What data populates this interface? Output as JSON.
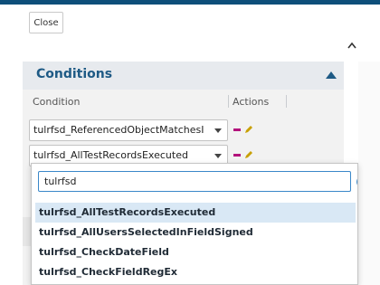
{
  "toolbar": {
    "close_label": "Close"
  },
  "conditions": {
    "title": "Conditions",
    "columns": {
      "condition": "Condition",
      "actions": "Actions"
    },
    "rows": [
      {
        "value": "tulrfsd_ReferencedObjectMatchesI"
      },
      {
        "value": "tulrfsd_AllTestRecordsExecuted"
      }
    ]
  },
  "dropdown": {
    "search_value": "tulrfsd",
    "options": [
      {
        "label": "tulrfsd_AllTestRecordsExecuted",
        "highlighted": true
      },
      {
        "label": "tulrfsd_AllUsersSelectedInFieldSigned",
        "highlighted": false
      },
      {
        "label": "tulrfsd_CheckDateField",
        "highlighted": false
      },
      {
        "label": "tulrfsd_CheckFieldRegEx",
        "highlighted": false
      }
    ]
  },
  "colors": {
    "accent": "#0e4f7a",
    "title": "#1e5a85",
    "delete": "#b3127c",
    "edit": "#c8a000",
    "highlight": "#d9e8f5",
    "clear": "#3a87c9"
  },
  "icons": {
    "collapse": "triangle-up-icon",
    "delete": "minus-icon",
    "edit": "pencil-icon",
    "clear": "clear-circle-icon"
  }
}
